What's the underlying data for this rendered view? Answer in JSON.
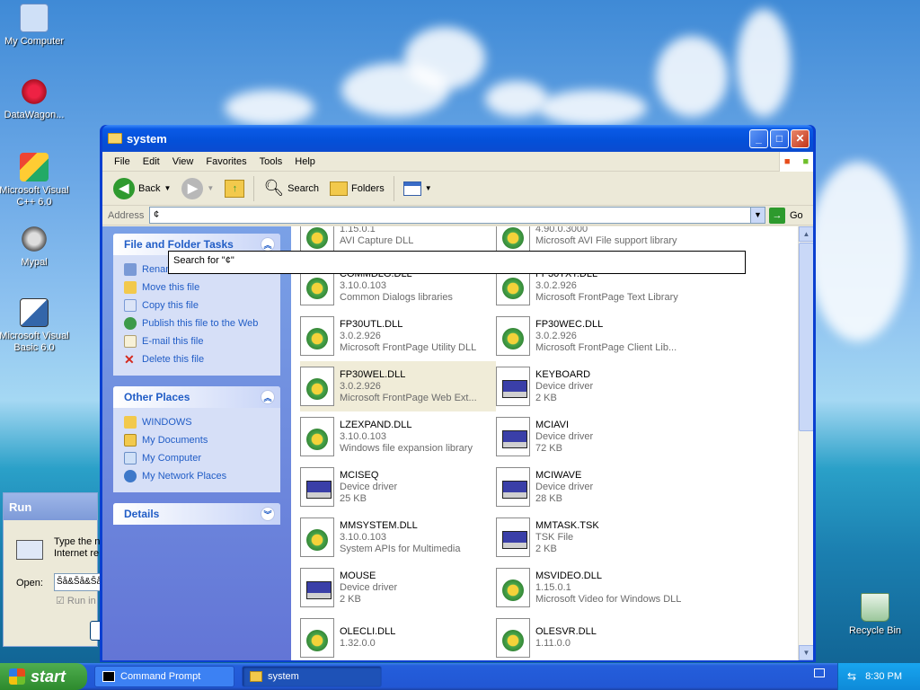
{
  "desktop": {
    "icons": [
      {
        "label": "My Computer"
      },
      {
        "label": "DataWagon..."
      },
      {
        "label": "Microsoft Visual C++ 6.0"
      },
      {
        "label": "Mypal"
      },
      {
        "label": "Microsoft Visual Basic 6.0"
      },
      {
        "label": "Recycle Bin"
      }
    ]
  },
  "window": {
    "title": "system",
    "menu": [
      "File",
      "Edit",
      "View",
      "Favorites",
      "Tools",
      "Help"
    ],
    "toolbar": {
      "back": "Back",
      "search": "Search",
      "folders": "Folders"
    },
    "address": {
      "label": "Address",
      "value": "¢",
      "go": "Go"
    },
    "autocomplete": "Search for \"¢\""
  },
  "left_pane": {
    "file_tasks": {
      "title": "File and Folder Tasks",
      "items": [
        "Rename this file",
        "Move this file",
        "Copy this file",
        "Publish this file to the Web",
        "E-mail this file",
        "Delete this file"
      ]
    },
    "other_places": {
      "title": "Other Places",
      "items": [
        "WINDOWS",
        "My Documents",
        "My Computer",
        "My Network Places"
      ]
    },
    "details": {
      "title": "Details"
    }
  },
  "files": [
    {
      "name": "",
      "line2": "1.15.0.1",
      "line3": "AVI Capture DLL",
      "type": "dll"
    },
    {
      "name": "",
      "line2": "4.90.0.3000",
      "line3": "Microsoft AVI File support library",
      "type": "dll"
    },
    {
      "name": "COMMDLG.DLL",
      "line2": "3.10.0.103",
      "line3": "Common Dialogs libraries",
      "type": "dll"
    },
    {
      "name": "FP30TXT.DLL",
      "line2": "3.0.2.926",
      "line3": "Microsoft FrontPage Text Library",
      "type": "dll"
    },
    {
      "name": "FP30UTL.DLL",
      "line2": "3.0.2.926",
      "line3": "Microsoft FrontPage Utility DLL",
      "type": "dll"
    },
    {
      "name": "FP30WEC.DLL",
      "line2": "3.0.2.926",
      "line3": "Microsoft FrontPage Client Lib...",
      "type": "dll"
    },
    {
      "name": "FP30WEL.DLL",
      "line2": "3.0.2.926",
      "line3": "Microsoft FrontPage Web Ext...",
      "type": "dll",
      "selected": true
    },
    {
      "name": "KEYBOARD",
      "line2": "Device driver",
      "line3": "2 KB",
      "type": "drv"
    },
    {
      "name": "LZEXPAND.DLL",
      "line2": "3.10.0.103",
      "line3": "Windows file expansion library",
      "type": "dll"
    },
    {
      "name": "MCIAVI",
      "line2": "Device driver",
      "line3": "72 KB",
      "type": "drv"
    },
    {
      "name": "MCISEQ",
      "line2": "Device driver",
      "line3": "25 KB",
      "type": "drv"
    },
    {
      "name": "MCIWAVE",
      "line2": "Device driver",
      "line3": "28 KB",
      "type": "drv"
    },
    {
      "name": "MMSYSTEM.DLL",
      "line2": "3.10.0.103",
      "line3": "System APIs for Multimedia",
      "type": "dll"
    },
    {
      "name": "MMTASK.TSK",
      "line2": "TSK File",
      "line3": "2 KB",
      "type": "drv"
    },
    {
      "name": "MOUSE",
      "line2": "Device driver",
      "line3": "2 KB",
      "type": "drv"
    },
    {
      "name": "MSVIDEO.DLL",
      "line2": "1.15.0.1",
      "line3": "Microsoft Video for Windows DLL",
      "type": "dll"
    },
    {
      "name": "OLECLI.DLL",
      "line2": "1.32.0.0",
      "line3": "",
      "type": "dll"
    },
    {
      "name": "OLESVR.DLL",
      "line2": "1.11.0.0",
      "line3": "",
      "type": "dll"
    }
  ],
  "run_dialog": {
    "title": "Run",
    "text1": "Type the n",
    "text2": "Internet re",
    "open_label": "Open:",
    "open_value": "Šå&Šå&Šå",
    "checkbox": "Run in"
  },
  "taskbar": {
    "start": "start",
    "items": [
      "Command Prompt",
      "system"
    ],
    "clock": "8:30 PM"
  },
  "colors": {
    "accent": "#0a5ae6",
    "link": "#215dc6",
    "start_green": "#2d8a2d"
  }
}
